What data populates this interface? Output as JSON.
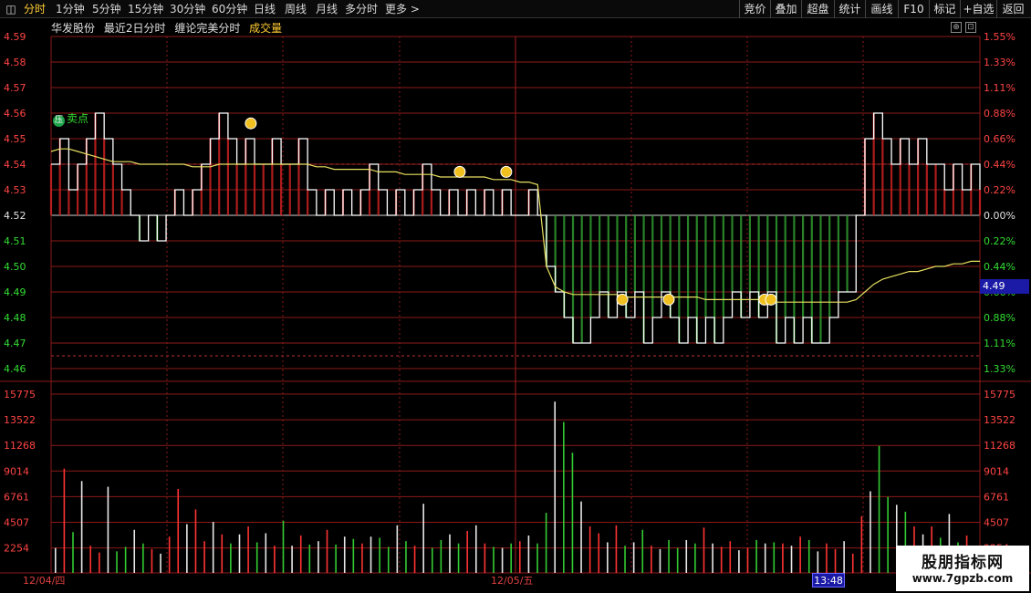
{
  "toolbar": {
    "window_button": "◫",
    "periods": [
      "分时",
      "1分钟",
      "5分钟",
      "15分钟",
      "30分钟",
      "60分钟",
      "日线",
      "周线",
      "月线",
      "多分时",
      "更多 >"
    ],
    "active_period": "分时",
    "right_buttons": [
      "竞价",
      "叠加",
      "超盘",
      "统计",
      "画线",
      "F10",
      "标记",
      "+自选",
      "返回"
    ]
  },
  "header": {
    "stock_name": "华发股份",
    "period_label": "最近2日分时",
    "indicator_name": "缠论完美分时",
    "volume_label": "成交量"
  },
  "corner_buttons": [
    "⊕",
    "⊡"
  ],
  "signals": {
    "sell_badge": "压",
    "sell_label": "卖点"
  },
  "current_price_tag": "4.49",
  "date_labels": {
    "day1": "12/04/四",
    "day2": "12/05/五"
  },
  "cursor_time": "13:48",
  "watermark": {
    "title": "股朋指标网",
    "url": "www.7gpzb.com"
  },
  "colors": {
    "up": "#ff3333",
    "down": "#33cc33",
    "grid": "#8b1a1a",
    "price_line": "#ffffff",
    "avg_line": "#e8e060",
    "label_up": "#ff4444",
    "label_down": "#33dd33",
    "label_base": "#e0e0e0"
  },
  "chart_data": [
    {
      "type": "line",
      "reference_price": 4.52,
      "y_ticks_price": [
        "4.59",
        "4.58",
        "4.57",
        "4.56",
        "4.55",
        "4.54",
        "4.53",
        "4.52",
        "4.51",
        "4.50",
        "4.49",
        "4.48",
        "4.47",
        "4.46"
      ],
      "y_ticks_pct": [
        "1.55%",
        "1.33%",
        "1.11%",
        "0.88%",
        "0.66%",
        "0.44%",
        "0.22%",
        "0.00%",
        "0.22%",
        "0.44%",
        "0.66%",
        "0.88%",
        "1.11%",
        "1.33%"
      ],
      "ylim": [
        4.46,
        4.59
      ],
      "x_sessions": [
        "12/04/四",
        "12/05/五"
      ],
      "series": [
        {
          "values": [
            4.54,
            4.55,
            4.53,
            4.54,
            4.55,
            4.56,
            4.55,
            4.54,
            4.53,
            4.52,
            4.51,
            4.52,
            4.51,
            4.52,
            4.53,
            4.52,
            4.53,
            4.54,
            4.55,
            4.56,
            4.55,
            4.54,
            4.55,
            4.54,
            4.54,
            4.55,
            4.54,
            4.54,
            4.55,
            4.53,
            4.52,
            4.53,
            4.52,
            4.53,
            4.52,
            4.53,
            4.54,
            4.53,
            4.52,
            4.53,
            4.52,
            4.53,
            4.54,
            4.53,
            4.52,
            4.53,
            4.52,
            4.53,
            4.52,
            4.53,
            4.52,
            4.53,
            4.52,
            4.52,
            4.53,
            4.52,
            4.5,
            4.49,
            4.48,
            4.47,
            4.47,
            4.48,
            4.49,
            4.48,
            4.49,
            4.48,
            4.49,
            4.47,
            4.48,
            4.49,
            4.48,
            4.47,
            4.48,
            4.47,
            4.48,
            4.47,
            4.48,
            4.49,
            4.48,
            4.49,
            4.48,
            4.49,
            4.47,
            4.48,
            4.47,
            4.48,
            4.47,
            4.47,
            4.48,
            4.49,
            4.49,
            4.52,
            4.55,
            4.56,
            4.55,
            4.54,
            4.55,
            4.54,
            4.55,
            4.54,
            4.54,
            4.53,
            4.54,
            4.53,
            4.54,
            4.53
          ]
        },
        {
          "values": [
            4.545,
            4.546,
            4.546,
            4.545,
            4.544,
            4.543,
            4.542,
            4.541,
            4.541,
            4.541,
            4.54,
            4.54,
            4.54,
            4.54,
            4.54,
            4.54,
            4.539,
            4.539,
            4.539,
            4.54,
            4.54,
            4.54,
            4.54,
            4.54,
            4.54,
            4.54,
            4.54,
            4.54,
            4.54,
            4.54,
            4.539,
            4.539,
            4.538,
            4.538,
            4.538,
            4.538,
            4.538,
            4.537,
            4.537,
            4.537,
            4.536,
            4.536,
            4.536,
            4.536,
            4.535,
            4.535,
            4.535,
            4.535,
            4.535,
            4.535,
            4.534,
            4.534,
            4.534,
            4.533,
            4.533,
            4.532,
            4.5,
            4.492,
            4.49,
            4.489,
            4.489,
            4.489,
            4.489,
            4.489,
            4.489,
            4.488,
            4.488,
            4.488,
            4.488,
            4.488,
            4.488,
            4.488,
            4.488,
            4.488,
            4.487,
            4.487,
            4.487,
            4.487,
            4.487,
            4.487,
            4.487,
            4.487,
            4.486,
            4.486,
            4.486,
            4.486,
            4.486,
            4.486,
            4.486,
            4.486,
            4.486,
            4.487,
            4.49,
            4.493,
            4.495,
            4.496,
            4.497,
            4.498,
            4.498,
            4.499,
            4.5,
            4.5,
            4.501,
            4.501,
            4.502,
            4.502
          ]
        }
      ]
    },
    {
      "type": "bar",
      "y_ticks": [
        "15775",
        "13522",
        "11268",
        "9014",
        "6761",
        "4507",
        "2254"
      ],
      "ylim": [
        0,
        18029
      ],
      "values": [
        2200,
        9200,
        3600,
        8100,
        2400,
        1800,
        7600,
        1900,
        2300,
        3800,
        2600,
        2100,
        1700,
        3200,
        7400,
        4300,
        5600,
        2800,
        4500,
        3400,
        2600,
        3400,
        4100,
        2700,
        3500,
        2400,
        4600,
        2400,
        3300,
        2500,
        2800,
        3800,
        2500,
        3200,
        3000,
        2600,
        3200,
        3100,
        2300,
        4200,
        2800,
        2400,
        6100,
        2200,
        2900,
        3400,
        2600,
        3700,
        4200,
        2600,
        2300,
        2200,
        2600,
        2800,
        3300,
        2600,
        5300,
        15100,
        13300,
        10600,
        6300,
        4100,
        3500,
        2700,
        4200,
        2400,
        2700,
        3800,
        2400,
        2100,
        2900,
        2200,
        2900,
        2600,
        4000,
        2600,
        2300,
        2800,
        2000,
        2200,
        2900,
        2600,
        2700,
        2600,
        2400,
        3200,
        2900,
        1900,
        2600,
        2100,
        2800,
        1700,
        5000,
        7200,
        11200,
        6700,
        6000,
        5400,
        4100,
        3400,
        4100,
        3100,
        5200,
        2700,
        3300,
        2300
      ]
    }
  ]
}
